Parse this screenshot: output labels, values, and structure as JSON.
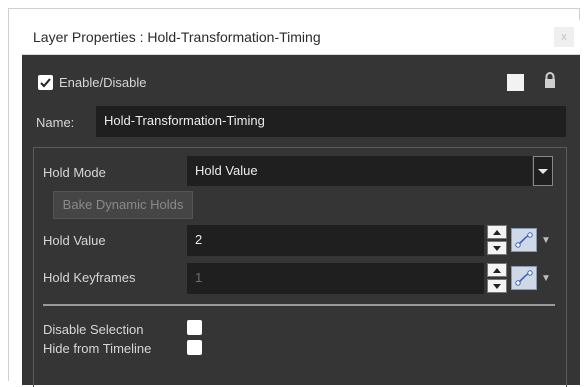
{
  "window": {
    "title": "Layer Properties : Hold-Transformation-Timing",
    "close_glyph": "x"
  },
  "enable": {
    "label": "Enable/Disable",
    "checked": true
  },
  "name": {
    "label": "Name:",
    "value": "Hold-Transformation-Timing"
  },
  "hold_mode": {
    "label": "Hold Mode",
    "value": "Hold Value"
  },
  "bake_button": {
    "label": "Bake Dynamic Holds"
  },
  "hold_value": {
    "label": "Hold Value",
    "value": "2"
  },
  "hold_keyframes": {
    "label": "Hold Keyframes",
    "value": "1"
  },
  "disable_selection": {
    "label": "Disable Selection",
    "checked": false
  },
  "hide_from_timeline": {
    "label": "Hide from Timeline",
    "checked": false
  },
  "icons": [
    "checkbox-icon",
    "color-swatch-icon",
    "lock-icon",
    "dropdown-arrow-icon",
    "spin-up-icon",
    "spin-down-icon",
    "function-curve-icon",
    "menu-arrow-icon"
  ]
}
